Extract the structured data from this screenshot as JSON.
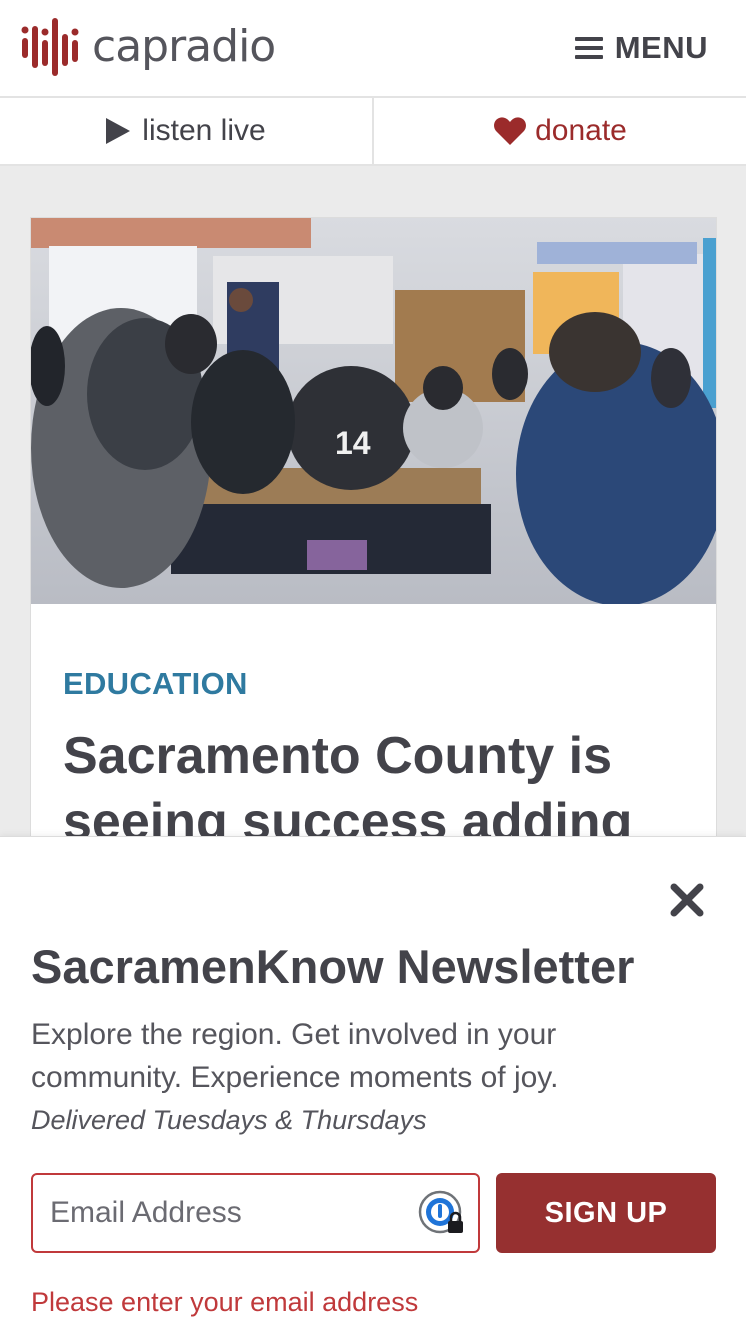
{
  "header": {
    "logo_text": "capradio",
    "menu_label": "MENU",
    "brand_color": "#9b2b2b"
  },
  "subnav": {
    "listen_label": "listen live",
    "donate_label": "donate"
  },
  "article": {
    "category": "EDUCATION",
    "headline": "Sacramento County is seeing success adding"
  },
  "newsletter": {
    "title": "SacramenKnow Newsletter",
    "description": "Explore the region. Get involved in your community. Experience moments of joy.",
    "schedule": "Delivered Tuesdays & Thursdays",
    "email_placeholder": "Email Address",
    "email_value": "",
    "signup_label": "SIGN UP",
    "error_message": "Please enter your email address",
    "error_color": "#c0393b",
    "button_color": "#963030"
  },
  "icons": {
    "logo": "capradio-waveform-logo",
    "menu": "hamburger-icon",
    "listen": "play-icon",
    "donate": "heart-icon",
    "close": "close-x-icon",
    "password_manager": "password-manager-key-icon"
  }
}
